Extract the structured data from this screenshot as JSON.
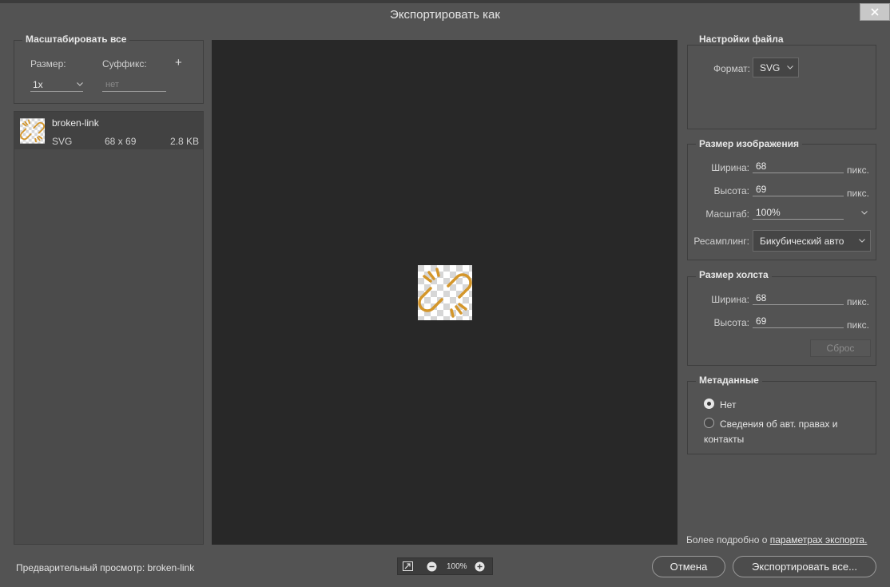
{
  "window": {
    "title": "Экспортировать как"
  },
  "scale_all": {
    "legend": "Масштабировать все",
    "size_label": "Размер:",
    "suffix_label": "Суффикс:",
    "add_label": "+",
    "size_value": "1x",
    "suffix_placeholder": "нет"
  },
  "assets": [
    {
      "name": "broken-link",
      "format": "SVG",
      "dimensions": "68 x 69",
      "filesize": "2.8 KB"
    }
  ],
  "file_settings": {
    "legend": "Настройки файла",
    "format_label": "Формат:",
    "format_value": "SVG"
  },
  "image_size": {
    "legend": "Размер изображения",
    "width_label": "Ширина:",
    "width_value": "68",
    "height_label": "Высота:",
    "height_value": "69",
    "unit": "пикс.",
    "scale_label": "Масштаб:",
    "scale_value": "100%",
    "resample_label": "Ресамплинг:",
    "resample_value": "Бикубический авто"
  },
  "canvas_size": {
    "legend": "Размер холста",
    "width_label": "Ширина:",
    "width_value": "68",
    "height_label": "Высота:",
    "height_value": "69",
    "unit": "пикс.",
    "reset_label": "Сброс"
  },
  "metadata": {
    "legend": "Метаданные",
    "option_none": "Нет",
    "option_copyright_line1": "Сведения об авт. правах и",
    "option_copyright_line2": "контакты",
    "selected": "none"
  },
  "more_info": {
    "prefix": "Более подробно о ",
    "link": "параметрах экспорта."
  },
  "preview": {
    "caption": "Предварительный просмотр: broken-link",
    "zoom": "100%"
  },
  "buttons": {
    "cancel": "Отмена",
    "export": "Экспортировать все..."
  },
  "colors": {
    "icon_accent": "#d4962a",
    "preview_bg": "#282828",
    "dialog_bg": "#535353"
  },
  "icons": {
    "preview_icon": "broken-link-icon",
    "close": "close-icon"
  }
}
